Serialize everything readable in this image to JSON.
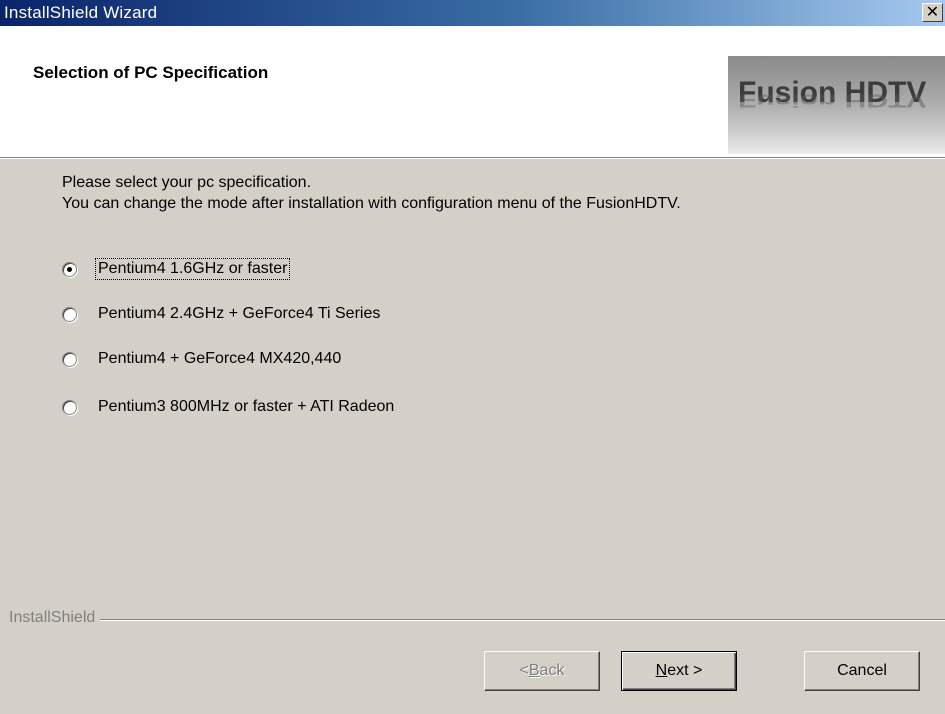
{
  "window": {
    "title": "InstallShield Wizard",
    "close_label": "✕"
  },
  "header": {
    "title": "Selection of PC Specification",
    "logo_text": "Fusion HDTV"
  },
  "instructions": {
    "line1": "Please select your pc specification.",
    "line2": "You can change the mode after installation with configuration menu of the FusionHDTV."
  },
  "options": [
    {
      "label": "Pentium4 1.6GHz or faster",
      "selected": true
    },
    {
      "label": "Pentium4 2.4GHz + GeForce4 Ti Series",
      "selected": false
    },
    {
      "label": "Pentium4 + GeForce4 MX420,440",
      "selected": false
    },
    {
      "label": "Pentium3 800MHz or faster + ATI Radeon",
      "selected": false
    }
  ],
  "footer": {
    "brand": "InstallShield",
    "back": {
      "pre": "< ",
      "mnemonic": "B",
      "post": "ack",
      "enabled": false
    },
    "next": {
      "pre": "",
      "mnemonic": "N",
      "post": "ext >",
      "enabled": true
    },
    "cancel": {
      "label": "Cancel",
      "enabled": true
    }
  },
  "colors": {
    "title_bar_start": "#0a246a",
    "title_bar_end": "#a6caf0",
    "dialog_bg": "#d4d0c8",
    "header_bg": "#ffffff"
  },
  "icons": [
    "close-icon",
    "fusion-hdtv-logo"
  ]
}
